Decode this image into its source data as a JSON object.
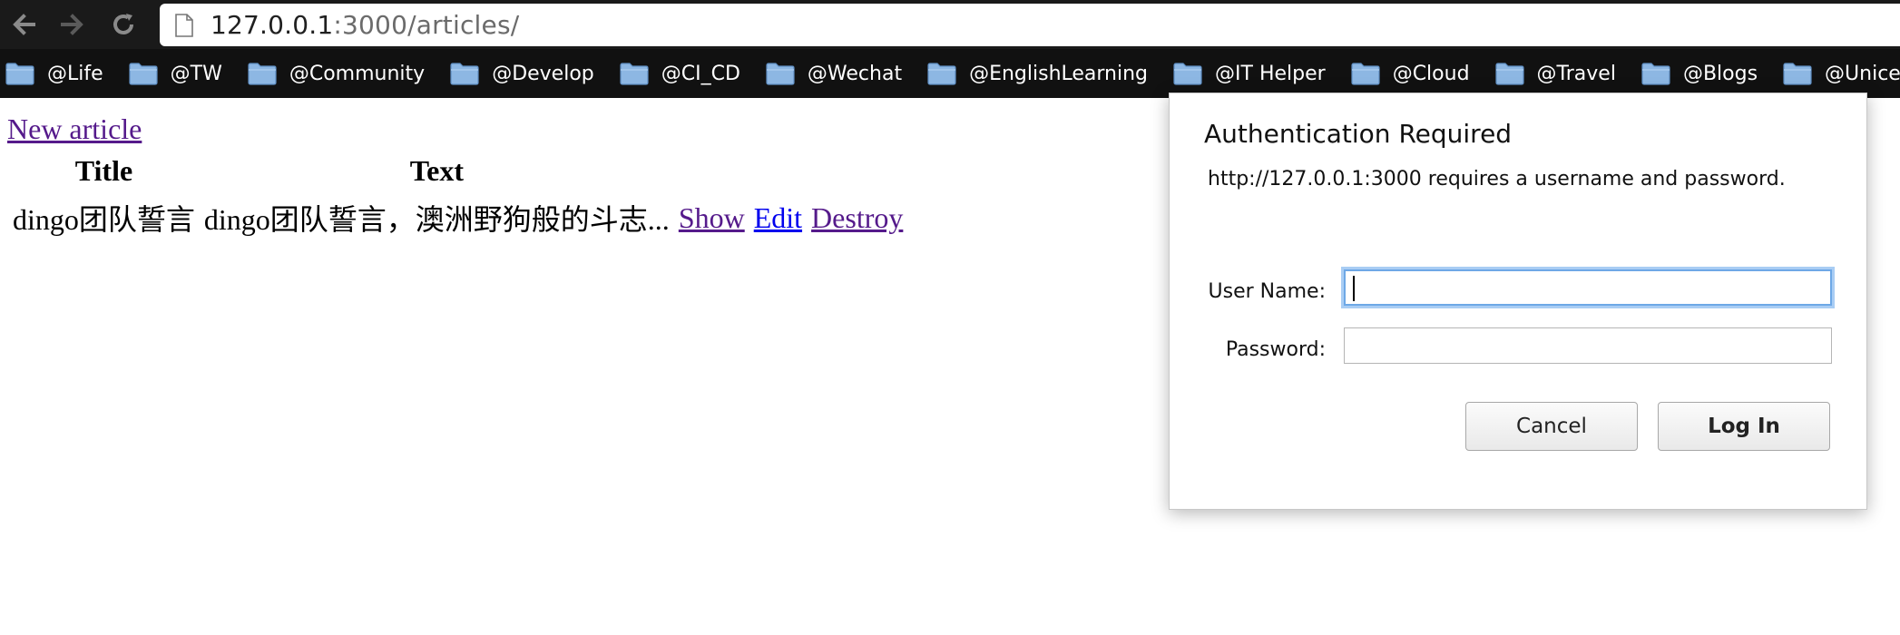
{
  "browser": {
    "url_host": "127.0.0.1",
    "url_rest": ":3000/articles/",
    "bookmarks": [
      "@Life",
      "@TW",
      "@Community",
      "@Develop",
      "@CI_CD",
      "@Wechat",
      "@EnglishLearning",
      "@IT Helper",
      "@Cloud",
      "@Travel",
      "@Blogs",
      "@Unicef"
    ]
  },
  "page": {
    "new_article_link": "New article",
    "table": {
      "headers": [
        "Title",
        "Text"
      ],
      "rows": [
        {
          "title": "dingo团队誓言",
          "text": "dingo团队誓言，澳洲野狗般的斗志...",
          "show": "Show",
          "edit": "Edit",
          "destroy": "Destroy"
        }
      ]
    }
  },
  "dialog": {
    "title": "Authentication Required",
    "message": "http://127.0.0.1:3000 requires a username and password.",
    "username_label": "User Name:",
    "password_label": "Password:",
    "username_value": "",
    "password_value": "",
    "cancel_label": "Cancel",
    "login_label": "Log In"
  }
}
